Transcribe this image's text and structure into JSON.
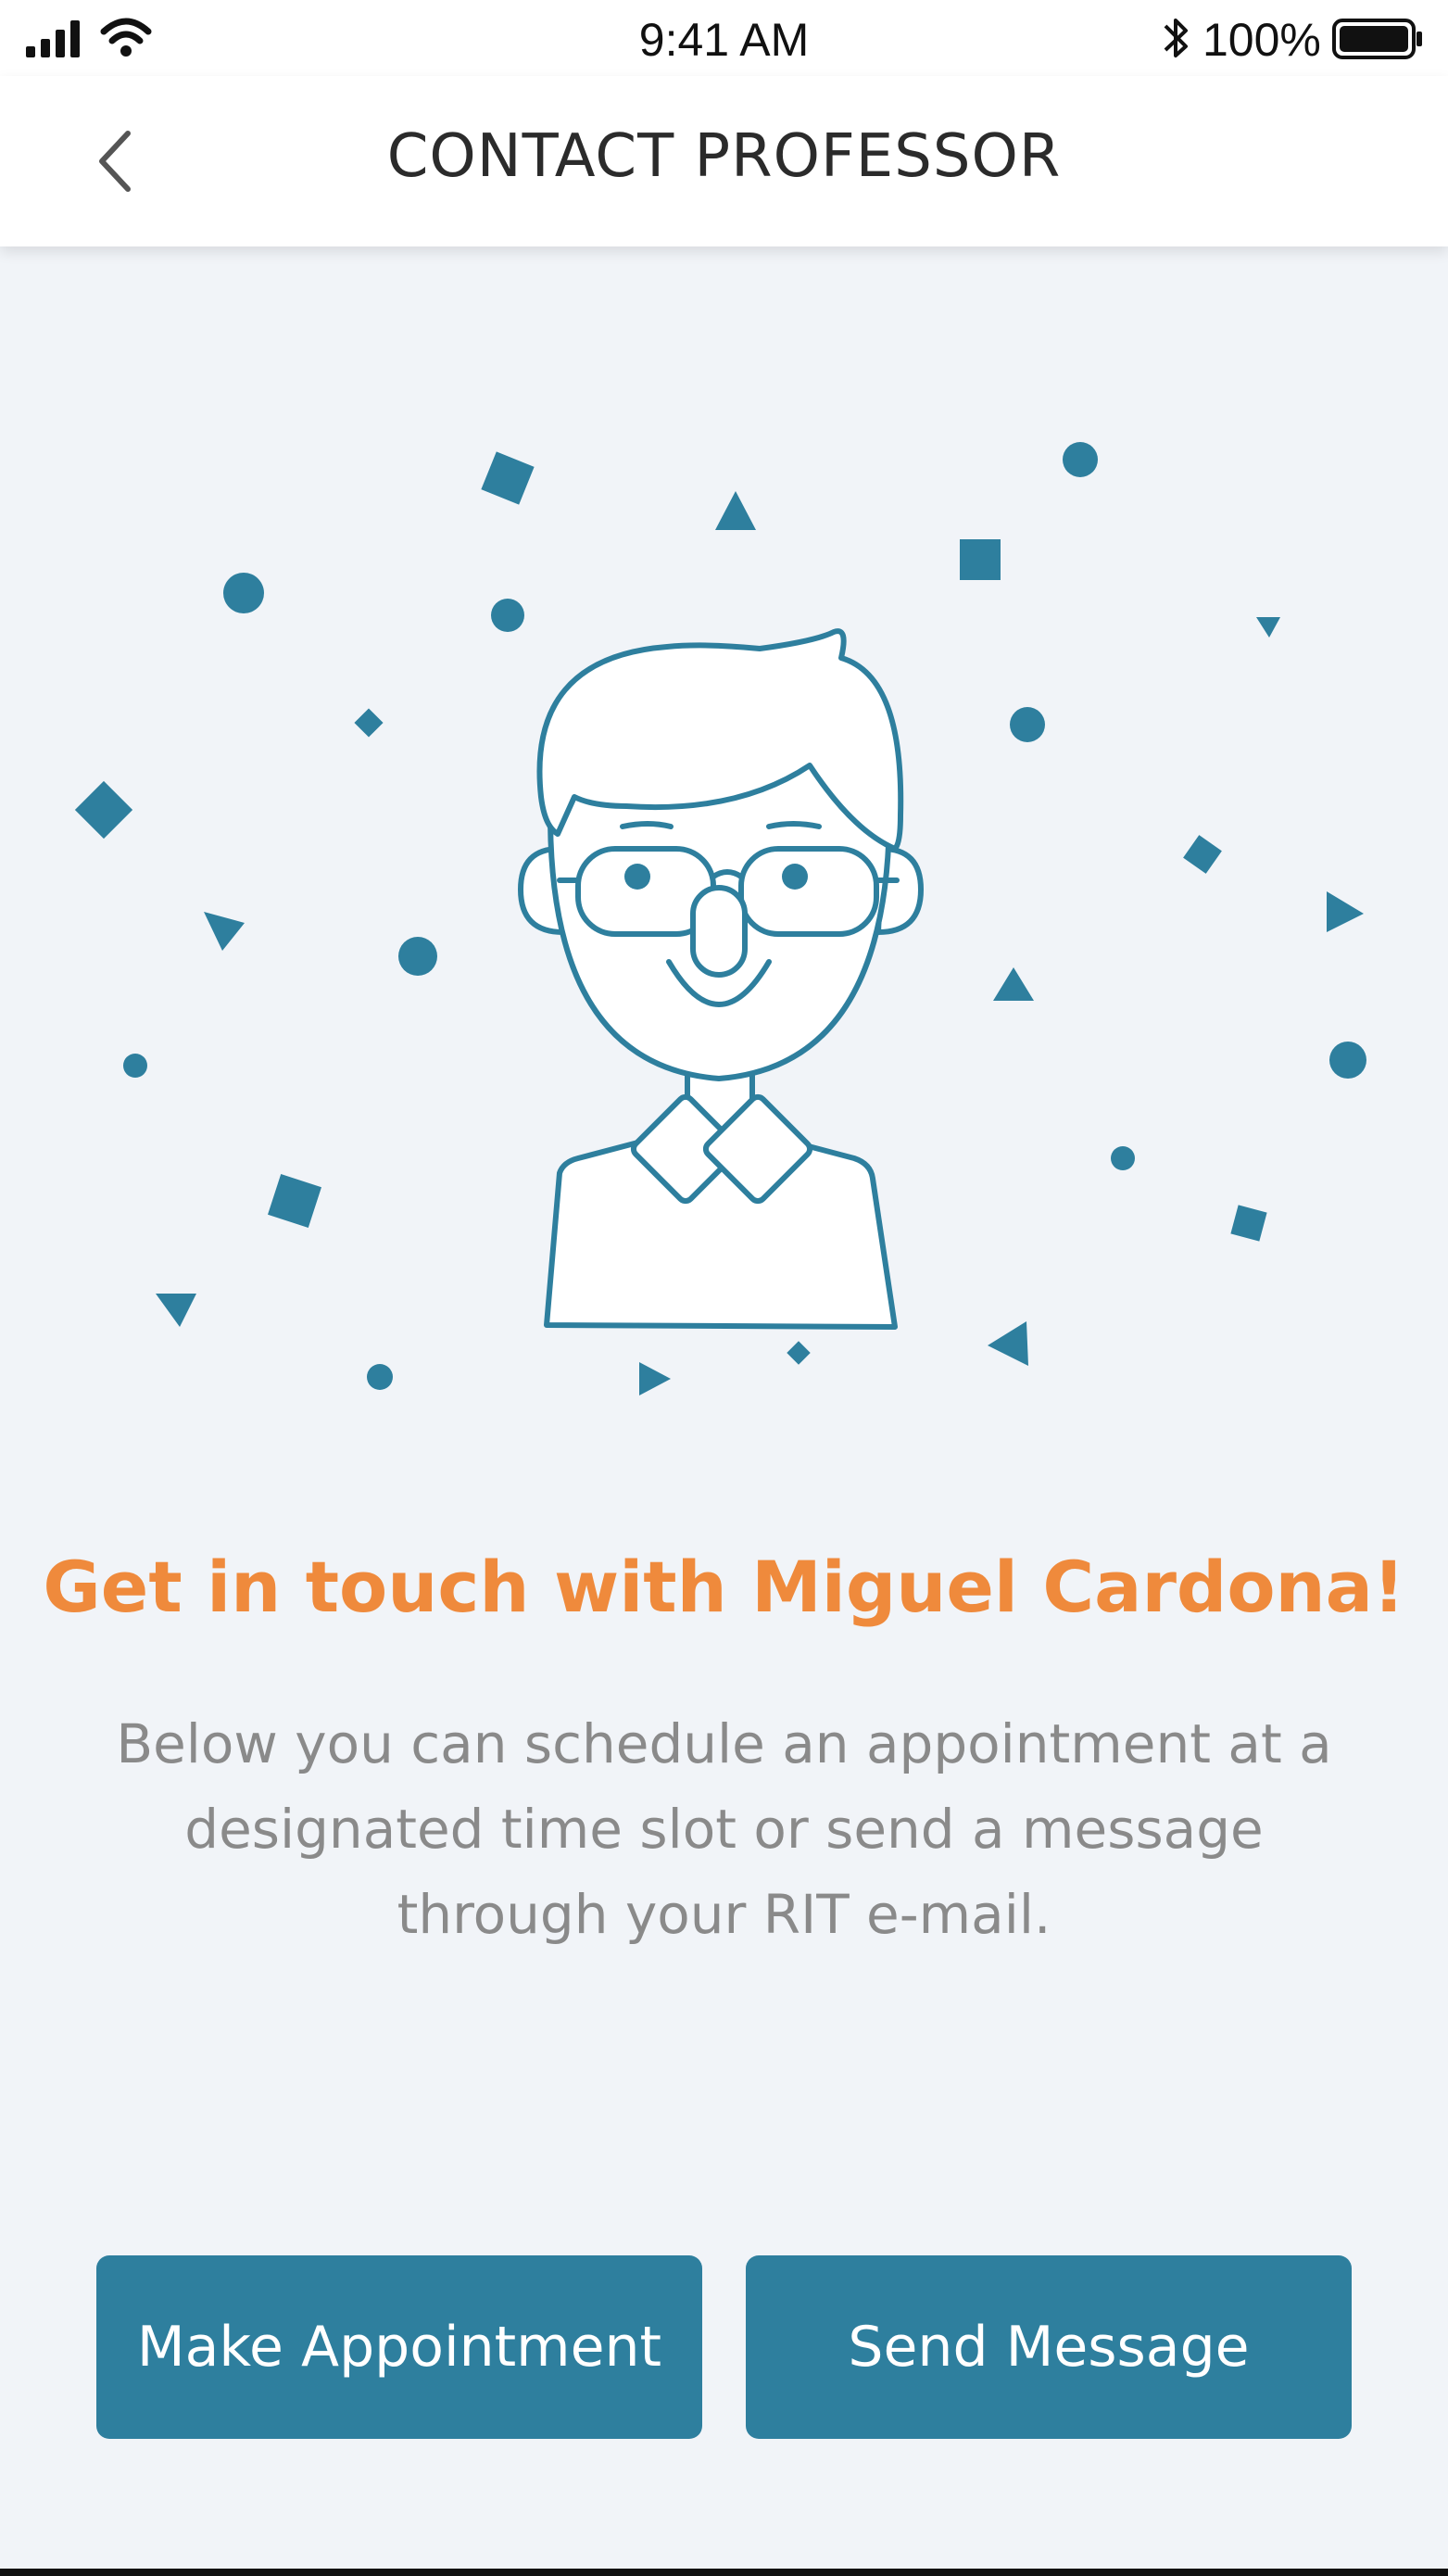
{
  "status_bar": {
    "time": "9:41 AM",
    "battery_percent": "100%",
    "icons": [
      "signal-icon",
      "wifi-icon",
      "bluetooth-icon",
      "battery-icon"
    ]
  },
  "nav": {
    "title": "CONTACT PROFESSOR",
    "back_icon": "chevron-left-icon"
  },
  "illustration": {
    "subject": "professor-avatar",
    "accent_color": "#2e7f9e"
  },
  "content": {
    "headline": "Get in touch with Miguel Cardona!",
    "description": "Below you can schedule an appointment at a designated time slot or send a message through your RIT e-mail."
  },
  "actions": {
    "make_appointment_label": "Make Appointment",
    "send_message_label": "Send Message"
  },
  "colors": {
    "primary": "#2e7f9e",
    "headline": "#ef8a3c",
    "background": "#f1f4f8",
    "body_text": "#8a8a8a"
  }
}
